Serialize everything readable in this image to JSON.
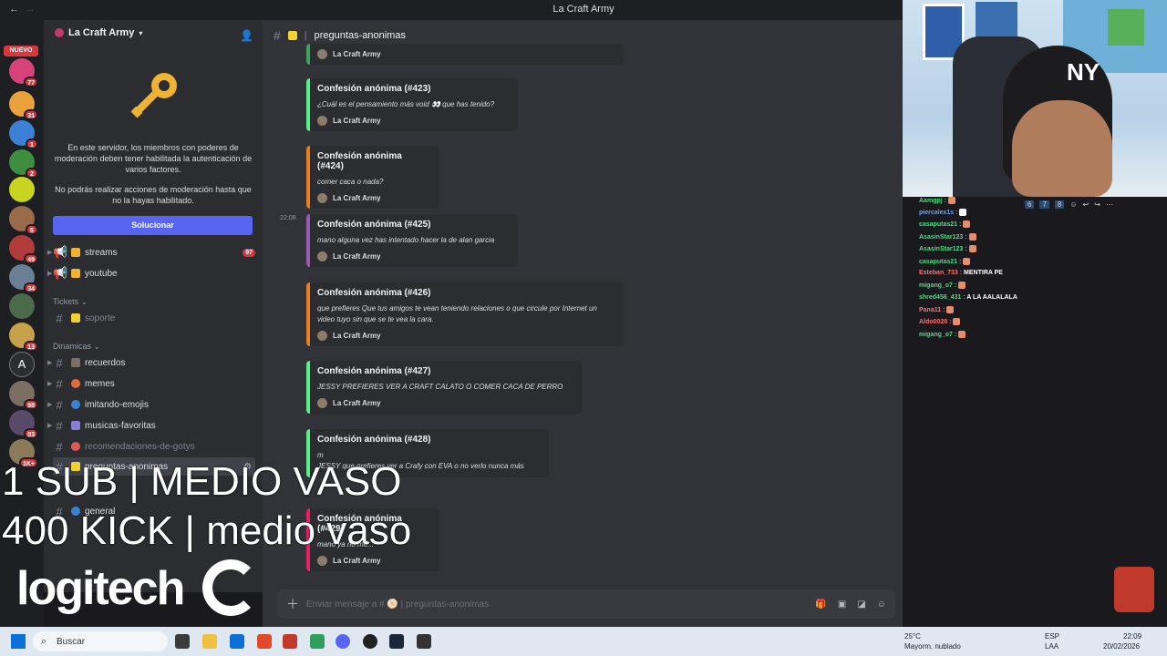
{
  "window": {
    "title": "La Craft Army"
  },
  "rail": {
    "nuevo": "NUEVO",
    "badges": [
      "77",
      "31",
      "1",
      "2",
      "5",
      "49",
      "34",
      "13",
      "98",
      "83",
      "1K+"
    ]
  },
  "sidebar": {
    "server_name": "La Craft Army",
    "mod_text_1": "En este servidor, los miembros con poderes de moderación deben tener habilitada la autenticación de varios factores.",
    "mod_text_2": "No podrás realizar acciones de moderación hasta que no la hayas habilitado.",
    "solve_button": "Solucionar",
    "channels_top": [
      {
        "label": "streams",
        "count": "97"
      },
      {
        "label": "youtube"
      }
    ],
    "cat_tickets": "Tickets",
    "soporte": "soporte",
    "cat_dinamicas": "Dinamicas",
    "channels_din": [
      {
        "label": "recuerdos"
      },
      {
        "label": "memes"
      },
      {
        "label": "imitando-emojis"
      },
      {
        "label": "musicas-favoritas"
      },
      {
        "label": "recomendaciones-de-gotys"
      },
      {
        "label": "preguntas-anonimas"
      },
      {
        "label": "general"
      }
    ]
  },
  "main": {
    "channel_title": "preguntas-anonimas",
    "author": "La Craft Army",
    "timestamp": "22:08",
    "embeds": [
      {
        "title": "Confesión anónima (#423)",
        "desc": "¿Cuál es el pensamiento más void 👀 que has tenido?"
      },
      {
        "title": "Confesión anónima (#424)",
        "desc": "comer caca o nada?"
      },
      {
        "title": "Confesión anónima (#425)",
        "desc": "mano alguna vez has intentado hacer la de alan garcia"
      },
      {
        "title": "Confesión anónima (#426)",
        "desc": "que prefieres Que tus amigos te vean teniendo relaciones o que circule por Internet un video tuyo sin que se te vea la cara."
      },
      {
        "title": "Confesión anónima (#427)",
        "desc": "JESSY PREFIERES VER A CRAFT CALATO O COMER CACA DE PERRO"
      },
      {
        "title": "Confesión anónima (#428)",
        "desc": "m",
        "desc2": "JESSY que prefieres ver a Crafy con EVA o no verlo nunca más"
      },
      {
        "title": "Confesión anónima (#429)",
        "desc": "mano ya no me..."
      }
    ],
    "input_placeholder": "Enviar mensaje a # 🫓 | preguntas-anonimas"
  },
  "chat": {
    "messages": [
      {
        "user": "Aamgpj :",
        "color": "g"
      },
      {
        "user": "piercalex1s :",
        "color": "b"
      },
      {
        "user": "casaputas21 :",
        "color": "g"
      },
      {
        "user": "AsasinStar123 :",
        "color": "g"
      },
      {
        "user": "AsasinStar123 :",
        "color": "g"
      },
      {
        "user": "casaputas21 :",
        "color": "g"
      },
      {
        "user": "Esteban_733 :",
        "color": "r",
        "text": "MENTIRA PE"
      },
      {
        "user": "migang_o7 :",
        "color": "g"
      },
      {
        "user": "shred456_431 :",
        "color": "g",
        "text": "A LA AALALALA"
      },
      {
        "user": "Pana11 :",
        "color": "r"
      },
      {
        "user": "Aldo0028 :",
        "color": "r"
      },
      {
        "user": "migang_o7 :",
        "color": "g"
      }
    ]
  },
  "overlay": {
    "line1": "1 SUB | MEDIO VASO",
    "line2": "400 KICK | medio vaso",
    "logo": "logitech"
  },
  "taskbar": {
    "search": "Buscar",
    "weather_temp": "25°C",
    "weather_desc": "Mayorm. nublado",
    "lang1": "ESP",
    "lang2": "LAA",
    "time": "22:09",
    "date": "20/02/2026"
  }
}
